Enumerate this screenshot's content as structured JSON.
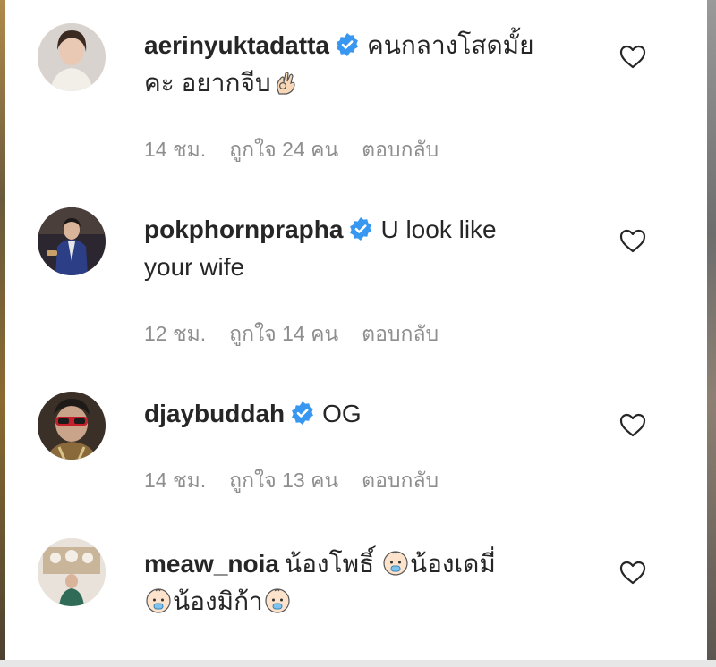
{
  "comments": [
    {
      "username": "aerinyuktadatta",
      "verified": true,
      "text_line1": "คนกลางโสดมั้ย",
      "text_line2": "คะ อยากจีบ",
      "time": "14 ชม.",
      "likes": "ถูกใจ 24 คน",
      "reply": "ตอบกลับ"
    },
    {
      "username": "pokphornprapha",
      "verified": true,
      "text_line1": "U look like",
      "text_line2": "your wife",
      "time": "12 ชม.",
      "likes": "ถูกใจ 14 คน",
      "reply": "ตอบกลับ"
    },
    {
      "username": "djaybuddah",
      "verified": true,
      "text_line1": "OG",
      "time": "14 ชม.",
      "likes": "ถูกใจ 13 คน",
      "reply": "ตอบกลับ"
    },
    {
      "username": "meaw_noia",
      "verified": false,
      "text_a": "น้องโพธิ์",
      "text_b": "น้องเดมี่",
      "text_c": "น้องมิก้า"
    }
  ],
  "icons": {
    "verified": "verified-badge-icon",
    "heart": "heart-outline-icon",
    "ok_hand": "ok-hand-emoji",
    "baby": "baby-emoji"
  },
  "colors": {
    "username": "#262626",
    "meta": "#8e8e8e",
    "verified": "#3897f0"
  }
}
